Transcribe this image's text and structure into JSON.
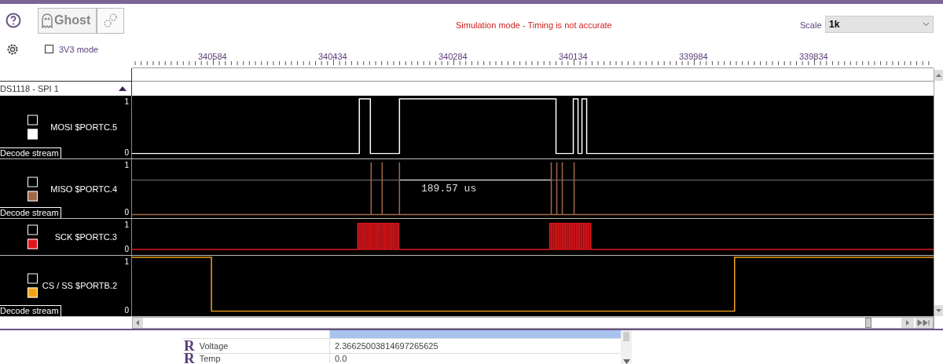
{
  "toolbar": {
    "ghost_button": "Ghost",
    "warning": "Simulation mode - Timing is not accurate",
    "scale_label": "Scale",
    "scale_value": "1k"
  },
  "options": {
    "mode_label": "3V3 mode",
    "checked": false
  },
  "ruler": {
    "labels": [
      "340584",
      "340434",
      "340284",
      "340134",
      "339984",
      "339834"
    ]
  },
  "group": {
    "title": "DS1118 - SPI 1",
    "expanded": true
  },
  "channels": [
    {
      "name": "MOSI $PORTC.5",
      "color": "#ffffff",
      "checked": false,
      "decode": "Decode stream",
      "high": "1",
      "low": "0"
    },
    {
      "name": "MISO $PORTC.4",
      "color": "#a0674b",
      "checked": false,
      "decode": "Decode stream",
      "high": "1",
      "low": "0",
      "measurement": "189.57 us"
    },
    {
      "name": "SCK $PORTC.3",
      "color": "#e0161b",
      "checked": false,
      "high": "1",
      "low": "0"
    },
    {
      "name": "CS / SS $PORTB.2",
      "color": "#f5a31a",
      "checked": false,
      "decode": "Decode stream",
      "high": "1",
      "low": "0"
    }
  ],
  "variables": [
    {
      "icon": "R",
      "name": "Voltage",
      "value": "2.36625003814697265625"
    },
    {
      "icon": "R",
      "name": "Temp",
      "value": "0.0"
    }
  ]
}
